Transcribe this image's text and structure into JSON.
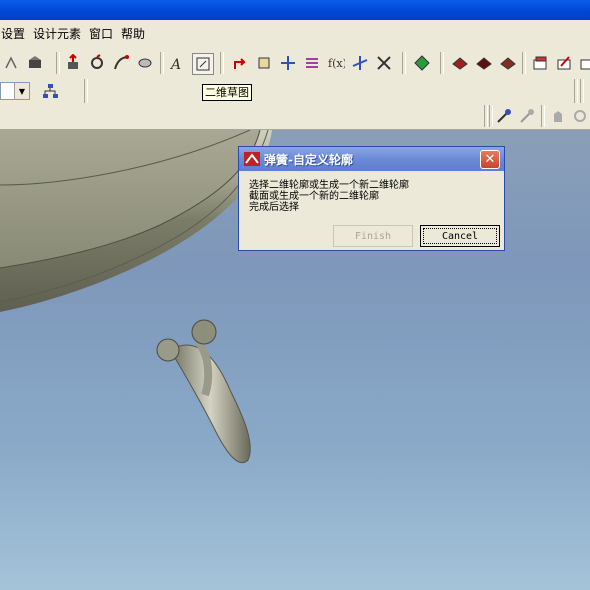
{
  "menu": [
    "设置",
    "设计元素",
    "窗口",
    "帮助"
  ],
  "tooltip": "二维草图",
  "dialog": {
    "title": "弹簧-自定义轮廓",
    "lines": [
      "选择二维轮廓或生成一个新二维轮廓",
      "截面或生成一个新的二维轮廓",
      "完成后选择"
    ],
    "finish_label": "Finish",
    "cancel_label": "Cancel"
  },
  "colors": {
    "title_blue": "#0046d5",
    "viewport_top": "#8a9fb7",
    "viewport_bottom": "#a5c3d8",
    "dialog_title": "#6b8ad6"
  }
}
